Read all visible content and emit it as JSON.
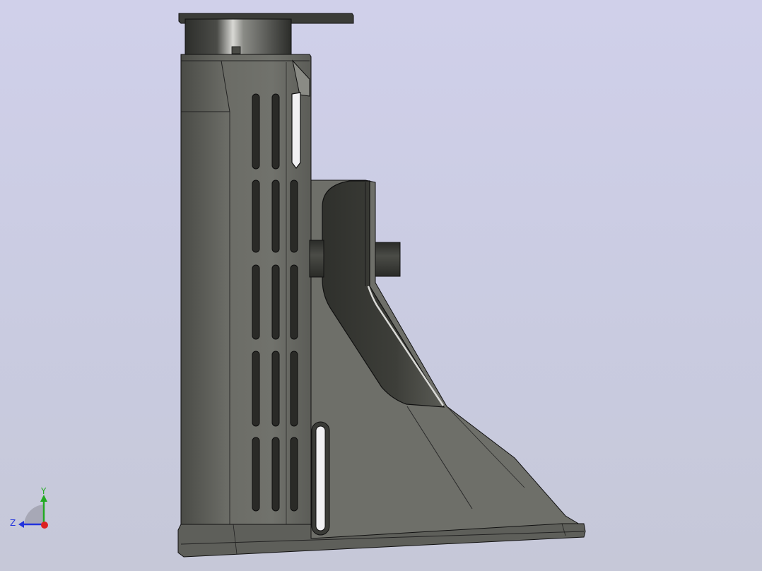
{
  "viewport": {
    "background_top": "#d0d0ea",
    "background_bottom": "#c6c8d8"
  },
  "model": {
    "body_color": "#6e6f69",
    "shadow_color": "#3a3b36",
    "edge_color": "#1b1b1b",
    "slot_color": "#2a2a27"
  },
  "triad": {
    "y_label": "Y",
    "z_label": "Z",
    "y_color": "#22aa22",
    "z_color": "#2233dd",
    "x_color": "#dd2222"
  }
}
